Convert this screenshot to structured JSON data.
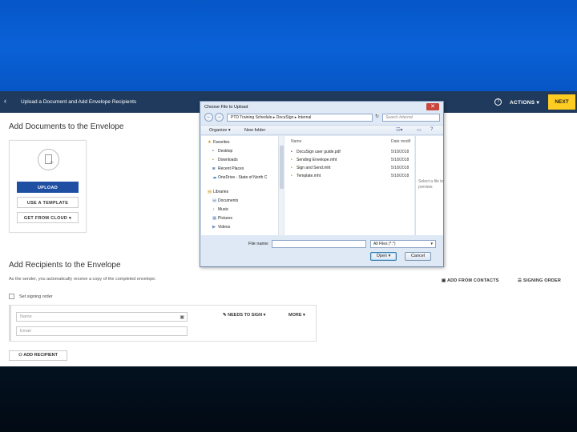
{
  "app": {
    "topbar": {
      "back_icon": "chevron-left-icon",
      "breadcrumb": "Upload a Document and Add Envelope Recipients",
      "help_icon": "help-icon",
      "help_glyph": "?",
      "actions_label": "ACTIONS",
      "next_label": "NEXT"
    },
    "documents": {
      "heading": "Add Documents to the Envelope",
      "upload_label": "UPLOAD",
      "template_label": "USE A TEMPLATE",
      "cloud_label": "GET FROM CLOUD"
    },
    "recipients": {
      "heading": "Add Recipients to the Envelope",
      "subtitle": "As the sender, you automatically receive a copy of the completed envelope.",
      "add_from_contacts": "ADD FROM CONTACTS",
      "signing_order_link": "SIGNING ORDER",
      "set_signing_order": "Set signing order",
      "name_placeholder": "Name",
      "email_placeholder": "Email",
      "needs_to_sign": "NEEDS TO SIGN",
      "more": "MORE",
      "add_recipient": "ADD RECIPIENT"
    }
  },
  "dialog": {
    "title": "Choose File to Upload",
    "close_glyph": "✕",
    "address_path": "PTD Training Schedule  ▸  DocuSign  ▸  Internal",
    "search_placeholder": "Search Internal",
    "organize": "Organize",
    "new_folder": "New folder",
    "nav": {
      "favorites": "Favorites",
      "favorites_items": [
        "Desktop",
        "Downloads",
        "Recent Places",
        "OneDrive - State of North C"
      ],
      "libraries": "Libraries",
      "libraries_items": [
        "Documents",
        "Music",
        "Pictures",
        "Videos"
      ]
    },
    "columns": {
      "name": "Name",
      "date": "Date modif"
    },
    "files": [
      {
        "name": "DocuSign user guide.pdf",
        "date": "5/18/2018"
      },
      {
        "name": "Sending Envelope.mht",
        "date": "5/18/2018"
      },
      {
        "name": "Sign and Send.mht",
        "date": "5/18/2018"
      },
      {
        "name": "Template.mht",
        "date": "5/18/2018"
      }
    ],
    "preview_text": "Select a file to preview.",
    "file_name_label": "File name:",
    "file_type": "All Files (*.*)",
    "open_label": "Open",
    "cancel_label": "Cancel"
  }
}
